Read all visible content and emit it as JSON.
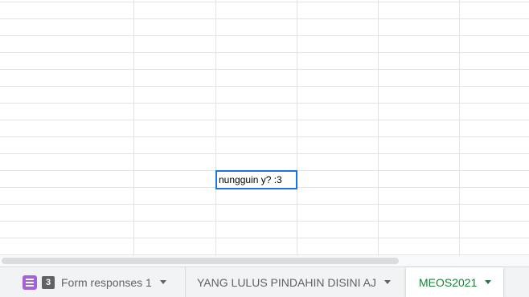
{
  "sheet": {
    "active_cell_text": "nungguin y? :3"
  },
  "tabs": [
    {
      "label": "Form responses 1",
      "badge": "3",
      "icon": "form-icon"
    },
    {
      "label": "YANG LULUS PINDAHIN DISINI AJ"
    },
    {
      "label": "MEOS2021",
      "active": true
    }
  ],
  "colors": {
    "selection": "#1a73e8",
    "active_tab_text": "#188038",
    "form_icon": "#a461d8"
  }
}
